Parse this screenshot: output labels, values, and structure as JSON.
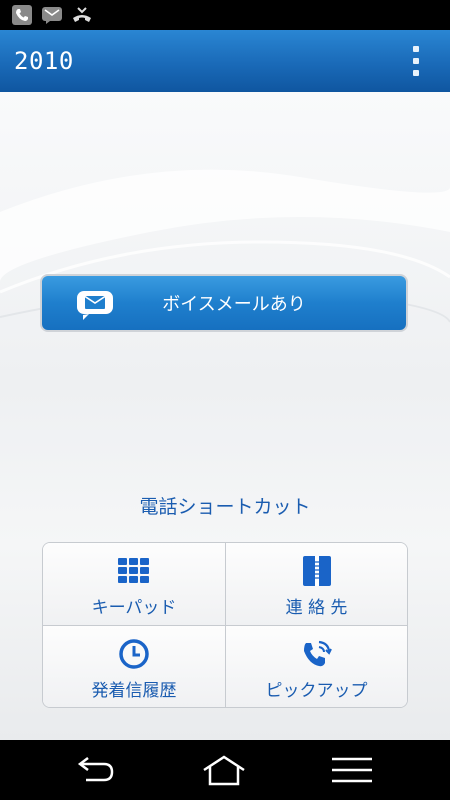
{
  "status_bar": {
    "icons": [
      "phone-icon",
      "voicemail-envelope-icon",
      "missed-call-icon"
    ]
  },
  "action_bar": {
    "title": "2010",
    "overflow_icon": "overflow-menu-icon"
  },
  "voicemail": {
    "label": "ボイスメールあり",
    "icon": "voicemail-icon"
  },
  "shortcuts": {
    "title": "電話ショートカット",
    "items": [
      {
        "label": "キーパッド",
        "icon": "keypad-icon"
      },
      {
        "label": "連 絡 先",
        "icon": "contacts-icon"
      },
      {
        "label": "発着信履歴",
        "icon": "call-history-icon"
      },
      {
        "label": "ピックアップ",
        "icon": "pickup-icon"
      }
    ]
  },
  "nav_bar": {
    "buttons": [
      "back-icon",
      "home-icon",
      "menu-icon"
    ]
  },
  "colors": {
    "action_bar": "#1a6ab8",
    "accent": "#1a5cb0",
    "button": "#1f7fcd"
  }
}
